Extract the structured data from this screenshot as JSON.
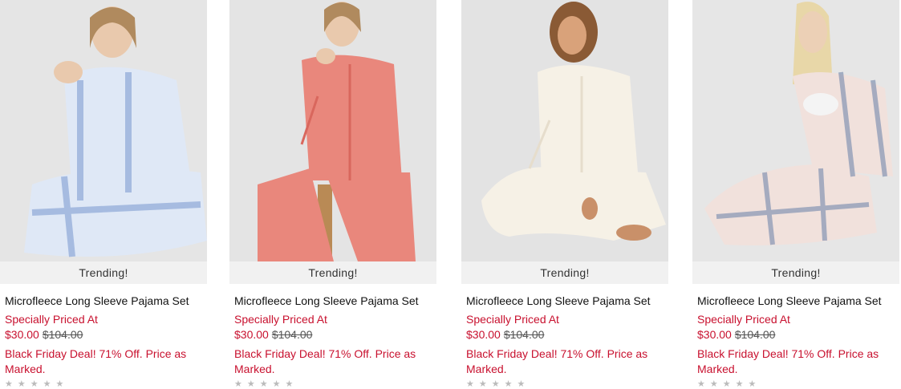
{
  "products": [
    {
      "badge": "Trending!",
      "title": "Microfleece Long Sleeve Pajama Set",
      "promo_label": "Specially Priced At",
      "sale_price": "$30.00",
      "original_price": "$104.00",
      "deal_text": "Black Friday Deal! 71% Off. Price as Marked.",
      "rating_stars": "★★★★★",
      "garment_color": "#dfe8f6",
      "accent_color": "#8ea9d8"
    },
    {
      "badge": "Trending!",
      "title": "Microfleece Long Sleeve Pajama Set",
      "promo_label": "Specially Priced At",
      "sale_price": "$30.00",
      "original_price": "$104.00",
      "deal_text": "Black Friday Deal! 71% Off. Price as Marked.",
      "rating_stars": "★★★★★",
      "garment_color": "#e9877c",
      "accent_color": "#d9675d"
    },
    {
      "badge": "Trending!",
      "title": "Microfleece Long Sleeve Pajama Set",
      "promo_label": "Specially Priced At",
      "sale_price": "$30.00",
      "original_price": "$104.00",
      "deal_text": "Black Friday Deal! 71% Off. Price as Marked.",
      "rating_stars": "★★★★★",
      "garment_color": "#f6f1e6",
      "accent_color": "#e6ddcc"
    },
    {
      "badge": "Trending!",
      "title": "Microfleece Long Sleeve Pajama Set",
      "promo_label": "Specially Priced At",
      "sale_price": "$30.00",
      "original_price": "$104.00",
      "deal_text": "Black Friday Deal! 71% Off. Price as Marked.",
      "rating_stars": "★★★★★",
      "garment_color": "#f1e1dc",
      "accent_color": "#7d8fb0"
    }
  ],
  "colors": {
    "promo_red": "#c8102e",
    "badge_bg": "#f1f1f1",
    "image_bg": "#e6e6e6"
  }
}
